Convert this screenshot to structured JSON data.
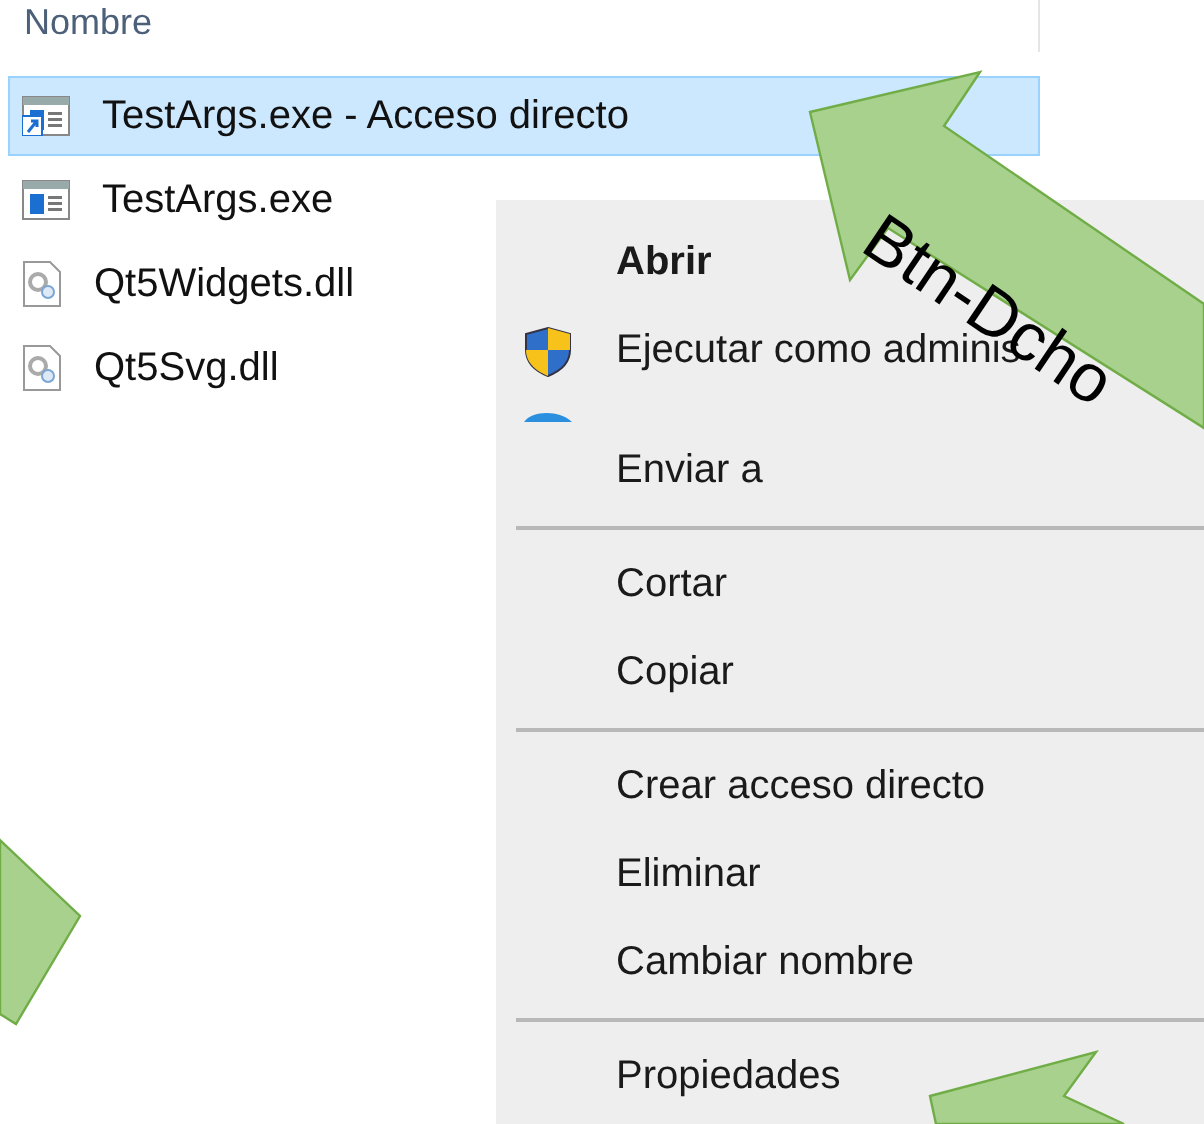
{
  "header": {
    "column": "Nombre"
  },
  "files": [
    {
      "name": "TestArgs.exe - Acceso directo",
      "kind": "shortcut",
      "selected": true
    },
    {
      "name": "TestArgs.exe",
      "kind": "exe",
      "selected": false
    },
    {
      "name": "Qt5Widgets.dll",
      "kind": "dll",
      "selected": false
    },
    {
      "name": "Qt5Svg.dll",
      "kind": "dll",
      "selected": false
    }
  ],
  "context_menu": {
    "items": [
      {
        "kind": "item",
        "label": "Abrir",
        "bold": true
      },
      {
        "kind": "shield_item",
        "label": "Ejecutar como adminis",
        "bold": false
      },
      {
        "kind": "cut_off"
      },
      {
        "kind": "item",
        "label": "Enviar a",
        "bold": false
      },
      {
        "kind": "separator"
      },
      {
        "kind": "item",
        "label": "Cortar",
        "bold": false
      },
      {
        "kind": "item",
        "label": "Copiar",
        "bold": false
      },
      {
        "kind": "separator"
      },
      {
        "kind": "item",
        "label": "Crear acceso directo",
        "bold": false
      },
      {
        "kind": "item",
        "label": "Eliminar",
        "bold": false
      },
      {
        "kind": "item",
        "label": "Cambiar nombre",
        "bold": false
      },
      {
        "kind": "separator"
      },
      {
        "kind": "item",
        "label": "Propiedades",
        "bold": false
      }
    ]
  },
  "annotations": [
    {
      "kind": "callout",
      "text": "Btn-Dcho"
    },
    {
      "kind": "arrow"
    },
    {
      "kind": "arrow"
    }
  ]
}
